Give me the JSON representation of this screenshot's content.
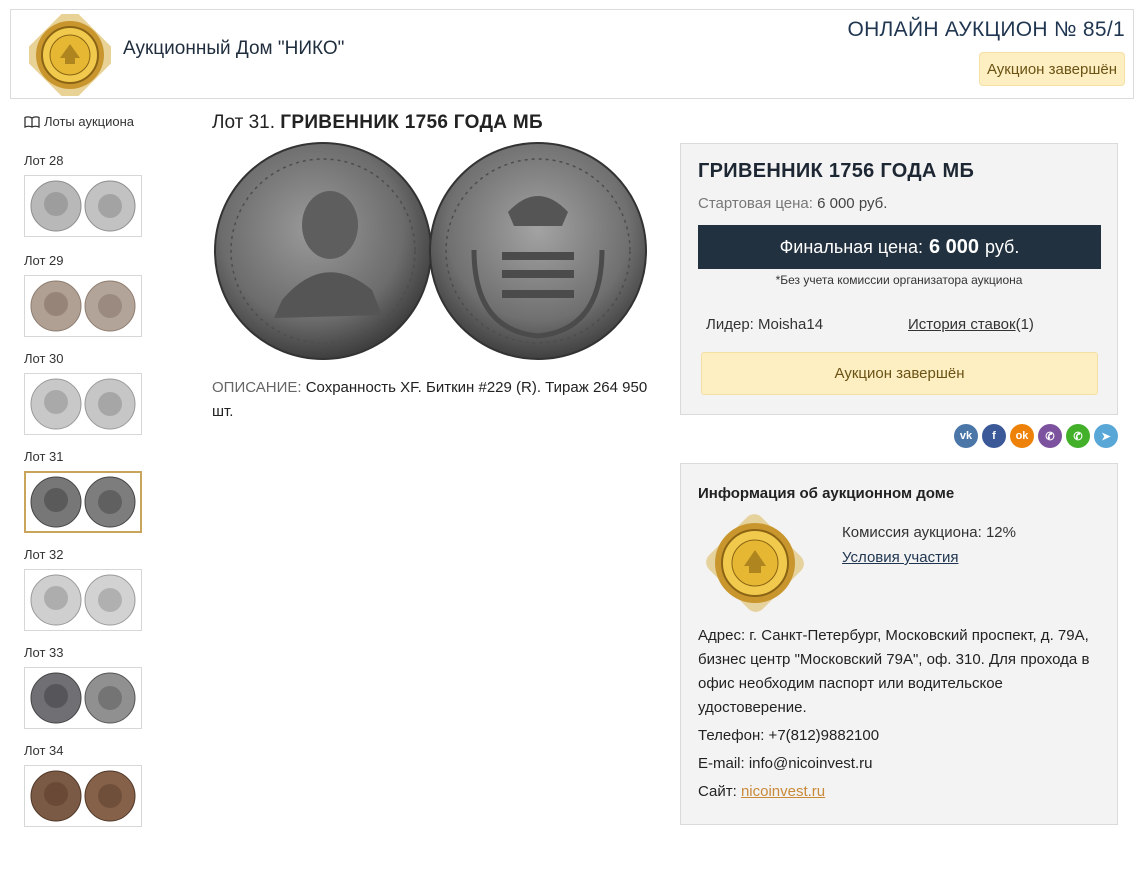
{
  "header": {
    "brand": "Аукционный Дом \"НИКО\"",
    "auction_title": "ОНЛАЙН АУКЦИОН № 85/1",
    "status": "Аукцион завершён"
  },
  "sidebar": {
    "lots_link": "Лоты аукциона",
    "lots": [
      {
        "label": "Лот 28"
      },
      {
        "label": "Лот 29"
      },
      {
        "label": "Лот 30"
      },
      {
        "label": "Лот 31",
        "active": true
      },
      {
        "label": "Лот 32"
      },
      {
        "label": "Лот 33"
      },
      {
        "label": "Лот 34"
      }
    ]
  },
  "lot": {
    "prefix": "Лот 31.",
    "title": "ГРИВЕННИК 1756 ГОДА МБ",
    "desc_key": "ОПИСАНИЕ:",
    "desc_text": "Сохранность XF. Биткин #229 (R). Тираж 264 950 шт."
  },
  "price_panel": {
    "title": "ГРИВЕННИК 1756 ГОДА МБ",
    "start_label": "Стартовая цена:",
    "start_value": "6 000 руб.",
    "final_label": "Финальная цена:",
    "final_value": "6 000",
    "final_currency": "руб.",
    "commission_note": "*Без учета комиссии организатора аукциона",
    "leader": "Лидер: Moisha14",
    "history_link": "История ставок",
    "history_count": "(1)",
    "status": "Аукцион завершён"
  },
  "share": [
    {
      "icon": "vk-icon",
      "glyph": "vk",
      "color": "#4a76a8"
    },
    {
      "icon": "facebook-icon",
      "glyph": "f",
      "color": "#3b5998"
    },
    {
      "icon": "odnoklassniki-icon",
      "glyph": "ok",
      "color": "#ee8208"
    },
    {
      "icon": "viber-icon",
      "glyph": "✆",
      "color": "#7c529e"
    },
    {
      "icon": "whatsapp-icon",
      "glyph": "✆",
      "color": "#43b02a"
    },
    {
      "icon": "telegram-icon",
      "glyph": "➤",
      "color": "#59a7d6"
    }
  ],
  "info": {
    "title": "Информация об аукционном доме",
    "commission": "Комиссия аукциона: 12%",
    "terms_link": "Условия участия",
    "address": "Адрес: г. Санкт-Петербург, Московский проспект, д. 79А, бизнес центр \"Московский 79А\", оф. 310. Для прохода в офис необходим паспорт или водительское удостоверение.",
    "phone": "Телефон: +7(812)9882100",
    "email": "E-mail: info@nicoinvest.ru",
    "site_label": "Сайт:",
    "site_link": "nicoinvest.ru"
  },
  "colors": {
    "accent_dark": "#22313f",
    "status_bg": "#fdefc2",
    "link_gold": "#c98a3a"
  }
}
